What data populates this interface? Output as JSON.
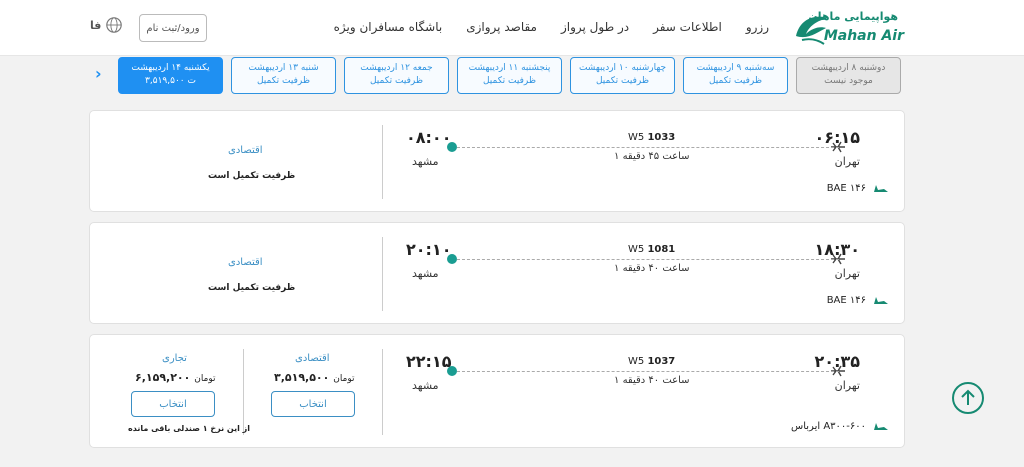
{
  "header": {
    "logo_fa": "هواپیمایی ماهان",
    "logo_en": "Mahan Air",
    "nav": [
      "رزرو",
      "اطلاعات سفر",
      "در طول پرواز",
      "مقاصد پروازی",
      "باشگاه مسافران ویژه"
    ],
    "login_label": "ورود/ثبت نام",
    "lang_label": "فا"
  },
  "dates": [
    {
      "day": "دوشنبه ۸ اردیبهشت",
      "status": "موجود نیست",
      "state": "disabled"
    },
    {
      "day": "سه‌شنبه ۹ اردیبهشت",
      "status": "ظرفیت تکمیل",
      "state": "normal"
    },
    {
      "day": "چهارشنبه ۱۰ اردیبهشت",
      "status": "ظرفیت تکمیل",
      "state": "normal"
    },
    {
      "day": "پنجشنبه ۱۱ اردیبهشت",
      "status": "ظرفیت تکمیل",
      "state": "normal"
    },
    {
      "day": "جمعه ۱۲ اردیبهشت",
      "status": "ظرفیت تکمیل",
      "state": "normal"
    },
    {
      "day": "شنبه ۱۳ اردیبهشت",
      "status": "ظرفیت تکمیل",
      "state": "normal"
    },
    {
      "day": "یکشنبه ۱۴ اردیبهشت",
      "status": "۳,۵۱۹,۵۰۰ ت",
      "state": "active"
    }
  ],
  "next_arrow": "›",
  "flights": [
    {
      "dep_time": "۰۶:۱۵",
      "dep_city": "تهران",
      "arr_time": "۰۸:۰۰",
      "arr_city": "مشهد",
      "airline": "W5",
      "number": "1033",
      "duration": "۱ ساعت ۴۵ دقیقه",
      "aircraft": "BAE ۱۴۶",
      "class_label": "اقتصادی",
      "full_label": "ظرفیت تکمیل است"
    },
    {
      "dep_time": "۱۸:۳۰",
      "dep_city": "تهران",
      "arr_time": "۲۰:۱۰",
      "arr_city": "مشهد",
      "airline": "W5",
      "number": "1081",
      "duration": "۱ ساعت ۴۰ دقیقه",
      "aircraft": "BAE ۱۴۶",
      "class_label": "اقتصادی",
      "full_label": "ظرفیت تکمیل است"
    },
    {
      "dep_time": "۲۰:۳۵",
      "dep_city": "تهران",
      "arr_time": "۲۲:۱۵",
      "arr_city": "مشهد",
      "airline": "W5",
      "number": "1037",
      "duration": "۱ ساعت ۴۰ دقیقه",
      "aircraft": "ایرباس A۳۰۰-۶۰۰",
      "economy": {
        "label": "اقتصادی",
        "price": "۳,۵۱۹,۵۰۰",
        "currency": "تومان",
        "button": "انتخاب"
      },
      "business": {
        "label": "تجاری",
        "price": "۶,۱۵۹,۲۰۰",
        "currency": "تومان",
        "button": "انتخاب",
        "note": "از این نرخ ۱ صندلی باقی مانده"
      }
    }
  ],
  "colors": {
    "brand": "#168a72",
    "accent": "#1f90f2",
    "dot": "#1a9d92",
    "link": "#3b8fc4"
  }
}
